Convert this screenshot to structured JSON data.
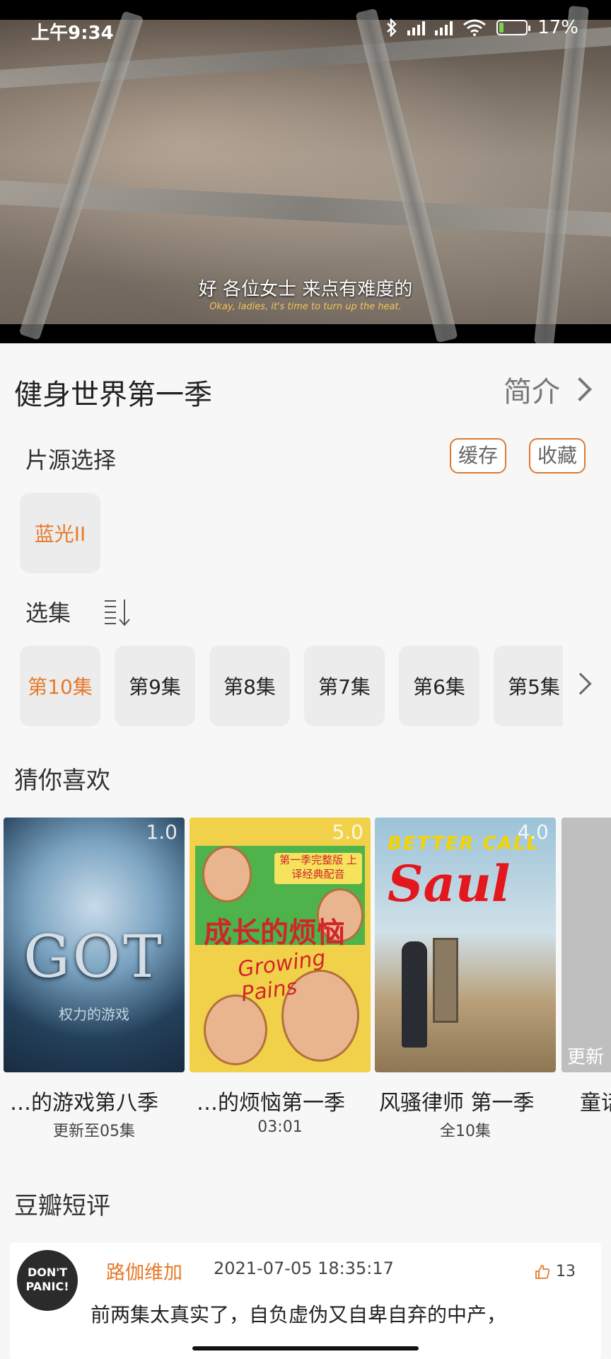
{
  "status_bar": {
    "time": "上午9:34",
    "battery": "17%",
    "battery_level": 0.17
  },
  "video": {
    "subtitle_cn": "好 各位女士 来点有难度的",
    "subtitle_en": "Okay, ladies, it's time to turn up the heat."
  },
  "header": {
    "title": "健身世界第一季",
    "intro_label": "简介"
  },
  "source": {
    "label": "片源选择",
    "cache_label": "缓存",
    "favorite_label": "收藏",
    "options": [
      "蓝光II"
    ],
    "selected": "蓝光II"
  },
  "episodes": {
    "label": "选集",
    "items": [
      "第10集",
      "第9集",
      "第8集",
      "第7集",
      "第6集",
      "第5集"
    ],
    "selected": "第10集"
  },
  "recommend": {
    "title": "猜你喜欢",
    "items": [
      {
        "name": "…的游戏第八季",
        "sub": "更新至05集",
        "score": "1.0"
      },
      {
        "name": "…的烦恼第一季",
        "sub": "03:01",
        "score": "5.0"
      },
      {
        "name": "风骚律师 第一季",
        "sub": "全10集",
        "score": "4.0"
      },
      {
        "name": "童话",
        "sub": "",
        "score": "",
        "overlay": "更新"
      }
    ],
    "poster_text": {
      "got_logo": "GOT",
      "got_sub": "权力的游戏",
      "gp_title": "成长的烦恼",
      "gp_sub": "Growing Pains",
      "gp_tag": "第一季完整版 上译经典配音",
      "bcs_line1": "BETTER CALL",
      "bcs_line2": "Saul"
    }
  },
  "reviews": {
    "title": "豆瓣短评",
    "items": [
      {
        "avatar_text": "DON'T PANIC!",
        "user": "路伽维加",
        "time": "2021-07-05 18:35:17",
        "likes": "13",
        "text": "前两集太真实了，自负虚伪又自卑自弃的中产，"
      }
    ]
  },
  "colors": {
    "accent": "#e77a2b",
    "tile_bg": "#ececec",
    "page_bg": "#f7f7f7"
  }
}
